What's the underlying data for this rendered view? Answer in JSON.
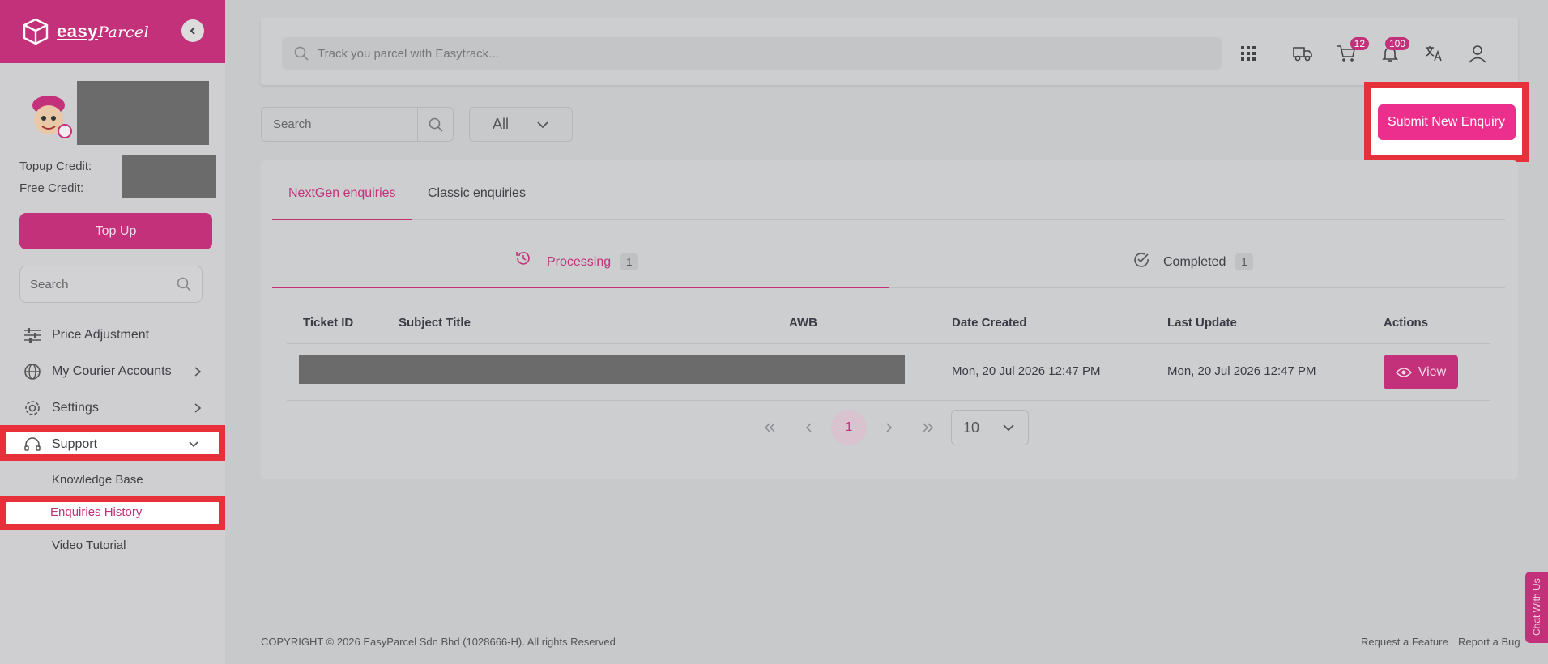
{
  "brand": {
    "name": "easy",
    "name_italic": "Parcel"
  },
  "sidebar": {
    "topup_credit_label": "Topup Credit:",
    "free_credit_label": "Free Credit:",
    "topup_button": "Top Up",
    "search_placeholder": "Search",
    "menu": {
      "price_adjustment": "Price Adjustment",
      "my_courier_accounts": "My Courier Accounts",
      "settings": "Settings",
      "support": "Support"
    },
    "support_sub": {
      "knowledge_base": "Knowledge Base",
      "enquiries_history": "Enquiries History",
      "video_tutorial": "Video Tutorial"
    }
  },
  "topbar": {
    "track_placeholder": "Track you parcel with Easytrack...",
    "cart_count": "12",
    "notification_count": "100"
  },
  "filters": {
    "search_placeholder": "Search",
    "status_select": "All",
    "submit_button": "Submit New Enquiry"
  },
  "tabs": {
    "nextgen": "NextGen enquiries",
    "classic": "Classic enquiries"
  },
  "subtabs": {
    "processing": {
      "label": "Processing",
      "count": "1"
    },
    "completed": {
      "label": "Completed",
      "count": "1"
    }
  },
  "table": {
    "headers": {
      "ticket_id": "Ticket ID",
      "subject_title": "Subject Title",
      "awb": "AWB",
      "date_created": "Date Created",
      "last_update": "Last Update",
      "actions": "Actions"
    },
    "rows": [
      {
        "date_created": "Mon, 20 Jul 2026 12:47 PM",
        "last_update": "Mon, 20 Jul 2026 12:47 PM",
        "action": "View"
      }
    ]
  },
  "pagination": {
    "current_page": "1",
    "page_size": "10"
  },
  "footer": {
    "copyright": "COPYRIGHT © 2026 EasyParcel Sdn Bhd (1028666-H). All rights Reserved",
    "request_feature": "Request a Feature",
    "report_bug": "Report a Bug"
  },
  "chat": "Chat With Us",
  "colors": {
    "brand": "#c2317a",
    "accent": "#ec2f8c",
    "highlight": "#e8303a"
  }
}
